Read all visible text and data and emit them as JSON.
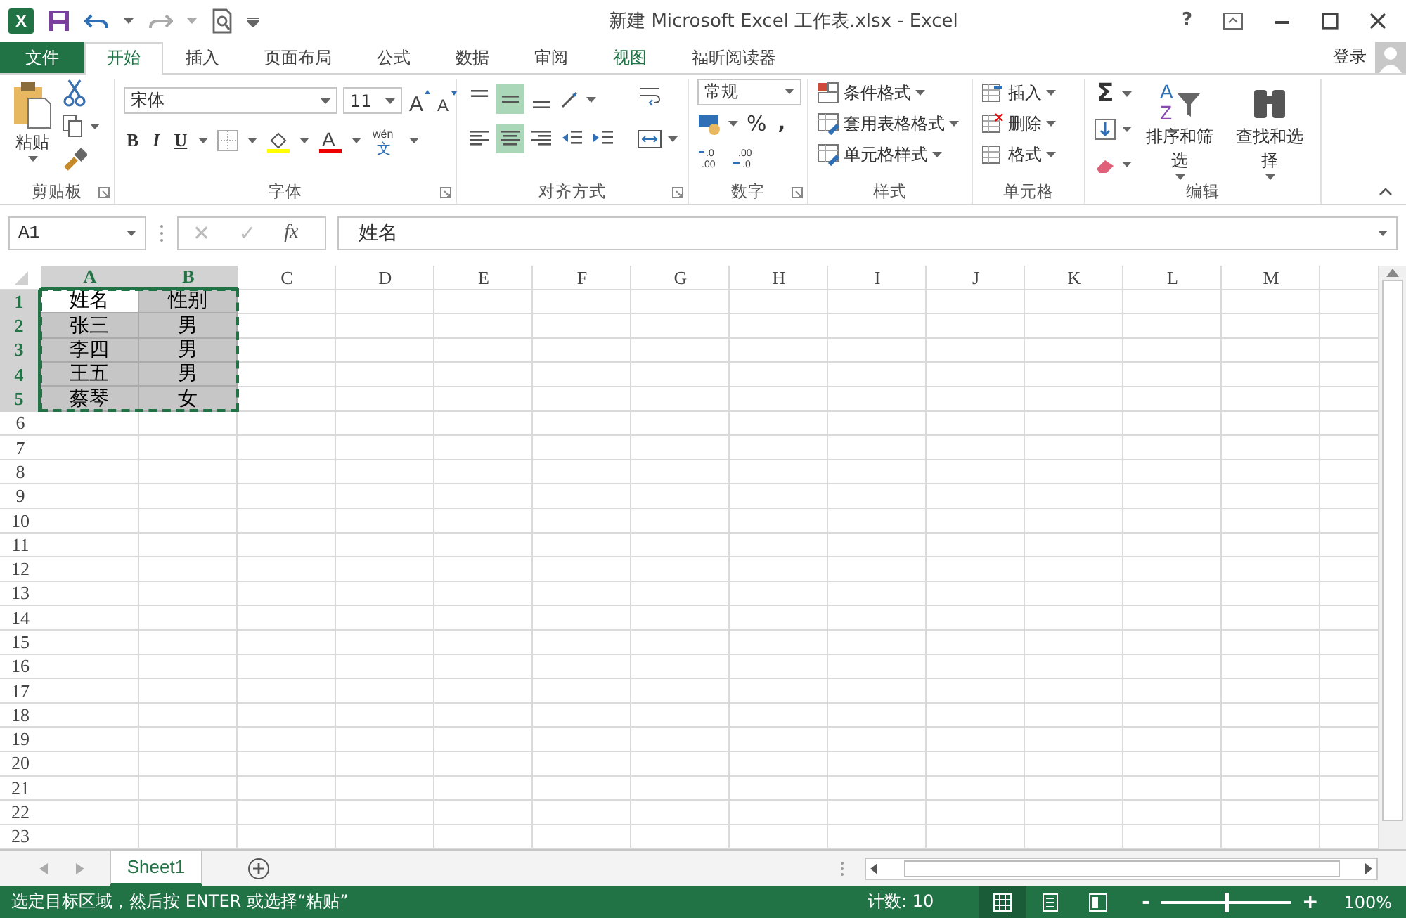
{
  "window": {
    "app_logo": "X",
    "title": "新建 Microsoft Excel 工作表.xlsx - Excel",
    "help": "?"
  },
  "tabs": [
    {
      "label": "文件",
      "kind": "file",
      "selected": false,
      "hover": false
    },
    {
      "label": "开始",
      "kind": "tab",
      "selected": true,
      "hover": false
    },
    {
      "label": "插入",
      "kind": "tab",
      "selected": false,
      "hover": false
    },
    {
      "label": "页面布局",
      "kind": "tab",
      "selected": false,
      "hover": false
    },
    {
      "label": "公式",
      "kind": "tab",
      "selected": false,
      "hover": false
    },
    {
      "label": "数据",
      "kind": "tab",
      "selected": false,
      "hover": false
    },
    {
      "label": "审阅",
      "kind": "tab",
      "selected": false,
      "hover": false
    },
    {
      "label": "视图",
      "kind": "tab",
      "selected": false,
      "hover": true
    },
    {
      "label": "福昕阅读器",
      "kind": "tab",
      "selected": false,
      "hover": false
    }
  ],
  "sign_in": "登录",
  "ribbon": {
    "clipboard": {
      "label": "剪贴板",
      "paste": "粘贴"
    },
    "font": {
      "label": "字体",
      "font_name": "宋体",
      "font_size": "11",
      "grow": "A",
      "shrink": "A",
      "bold": "B",
      "italic": "I",
      "underline": "U",
      "font_color": "A",
      "phonetic_top": "wén",
      "phonetic_bottom": "文"
    },
    "alignment": {
      "label": "对齐方式",
      "buttons": [
        {
          "kind": "top",
          "selected": false
        },
        {
          "kind": "middle",
          "selected": true
        },
        {
          "kind": "bottom",
          "selected": false
        },
        {
          "kind": "left",
          "selected": false
        },
        {
          "kind": "center",
          "selected": true
        },
        {
          "kind": "right",
          "selected": false
        },
        {
          "kind": "outdent",
          "selected": false
        },
        {
          "kind": "indent",
          "selected": false
        }
      ]
    },
    "number": {
      "label": "数字",
      "format": "常规",
      "percent": "%",
      "comma": ",",
      "increase_decimal": [
        ".0",
        ".00"
      ],
      "decrease_decimal": [
        ".00",
        ".0"
      ]
    },
    "styles": {
      "label": "样式",
      "items": [
        "条件格式",
        "套用表格格式",
        "单元格样式"
      ]
    },
    "cells": {
      "label": "单元格",
      "items": [
        "插入",
        "删除",
        "格式"
      ]
    },
    "editing": {
      "label": "编辑",
      "autosum": "Σ",
      "sort_letters": [
        "A",
        "Z"
      ],
      "sort": "排序和筛选",
      "find": "查找和选择"
    }
  },
  "formula_bar": {
    "name_box": "A1",
    "cancel": "✕",
    "enter": "✓",
    "function": "fx",
    "value": "姓名"
  },
  "table": {
    "marquee": true,
    "columns": [
      {
        "label": "A",
        "selected": true
      },
      {
        "label": "B",
        "selected": true
      },
      {
        "label": "C",
        "selected": false
      },
      {
        "label": "D",
        "selected": false
      },
      {
        "label": "E",
        "selected": false
      },
      {
        "label": "F",
        "selected": false
      },
      {
        "label": "G",
        "selected": false
      },
      {
        "label": "H",
        "selected": false
      },
      {
        "label": "I",
        "selected": false
      },
      {
        "label": "J",
        "selected": false
      },
      {
        "label": "K",
        "selected": false
      },
      {
        "label": "L",
        "selected": false
      },
      {
        "label": "M",
        "selected": false
      }
    ],
    "rows": [
      {
        "label": "1",
        "selected": true,
        "cells": [
          {
            "text": "姓名",
            "selected": true,
            "active": true
          },
          {
            "text": "性别",
            "selected": true,
            "active": false
          }
        ]
      },
      {
        "label": "2",
        "selected": true,
        "cells": [
          {
            "text": "张三",
            "selected": true,
            "active": false
          },
          {
            "text": "男",
            "selected": true,
            "active": false
          }
        ]
      },
      {
        "label": "3",
        "selected": true,
        "cells": [
          {
            "text": "李四",
            "selected": true,
            "active": false
          },
          {
            "text": "男",
            "selected": true,
            "active": false
          }
        ]
      },
      {
        "label": "4",
        "selected": true,
        "cells": [
          {
            "text": "王五",
            "selected": true,
            "active": false
          },
          {
            "text": "男",
            "selected": true,
            "active": false
          }
        ]
      },
      {
        "label": "5",
        "selected": true,
        "cells": [
          {
            "text": "蔡琴",
            "selected": true,
            "active": false
          },
          {
            "text": "女",
            "selected": true,
            "active": false
          }
        ]
      },
      {
        "label": "6",
        "selected": false
      },
      {
        "label": "7",
        "selected": false
      },
      {
        "label": "8",
        "selected": false
      },
      {
        "label": "9",
        "selected": false
      },
      {
        "label": "10",
        "selected": false
      },
      {
        "label": "11",
        "selected": false
      },
      {
        "label": "12",
        "selected": false
      },
      {
        "label": "13",
        "selected": false
      },
      {
        "label": "14",
        "selected": false
      },
      {
        "label": "15",
        "selected": false
      },
      {
        "label": "16",
        "selected": false
      },
      {
        "label": "17",
        "selected": false
      },
      {
        "label": "18",
        "selected": false
      },
      {
        "label": "19",
        "selected": false
      },
      {
        "label": "20",
        "selected": false
      },
      {
        "label": "21",
        "selected": false
      },
      {
        "label": "22",
        "selected": false
      },
      {
        "label": "23",
        "selected": false
      }
    ]
  },
  "sheets": [
    {
      "label": "Sheet1",
      "selected": true
    }
  ],
  "status_bar": {
    "message": "选定目标区域，然后按 ENTER 或选择“粘贴”",
    "count": "计数: 10",
    "views": [
      {
        "kind": "normal",
        "selected": true
      },
      {
        "kind": "layout",
        "selected": false
      },
      {
        "kind": "break",
        "selected": false
      }
    ],
    "zoom_out": "-",
    "zoom_in": "+",
    "zoom": {
      "level": 0.5
    },
    "zoom_label": "100%"
  }
}
